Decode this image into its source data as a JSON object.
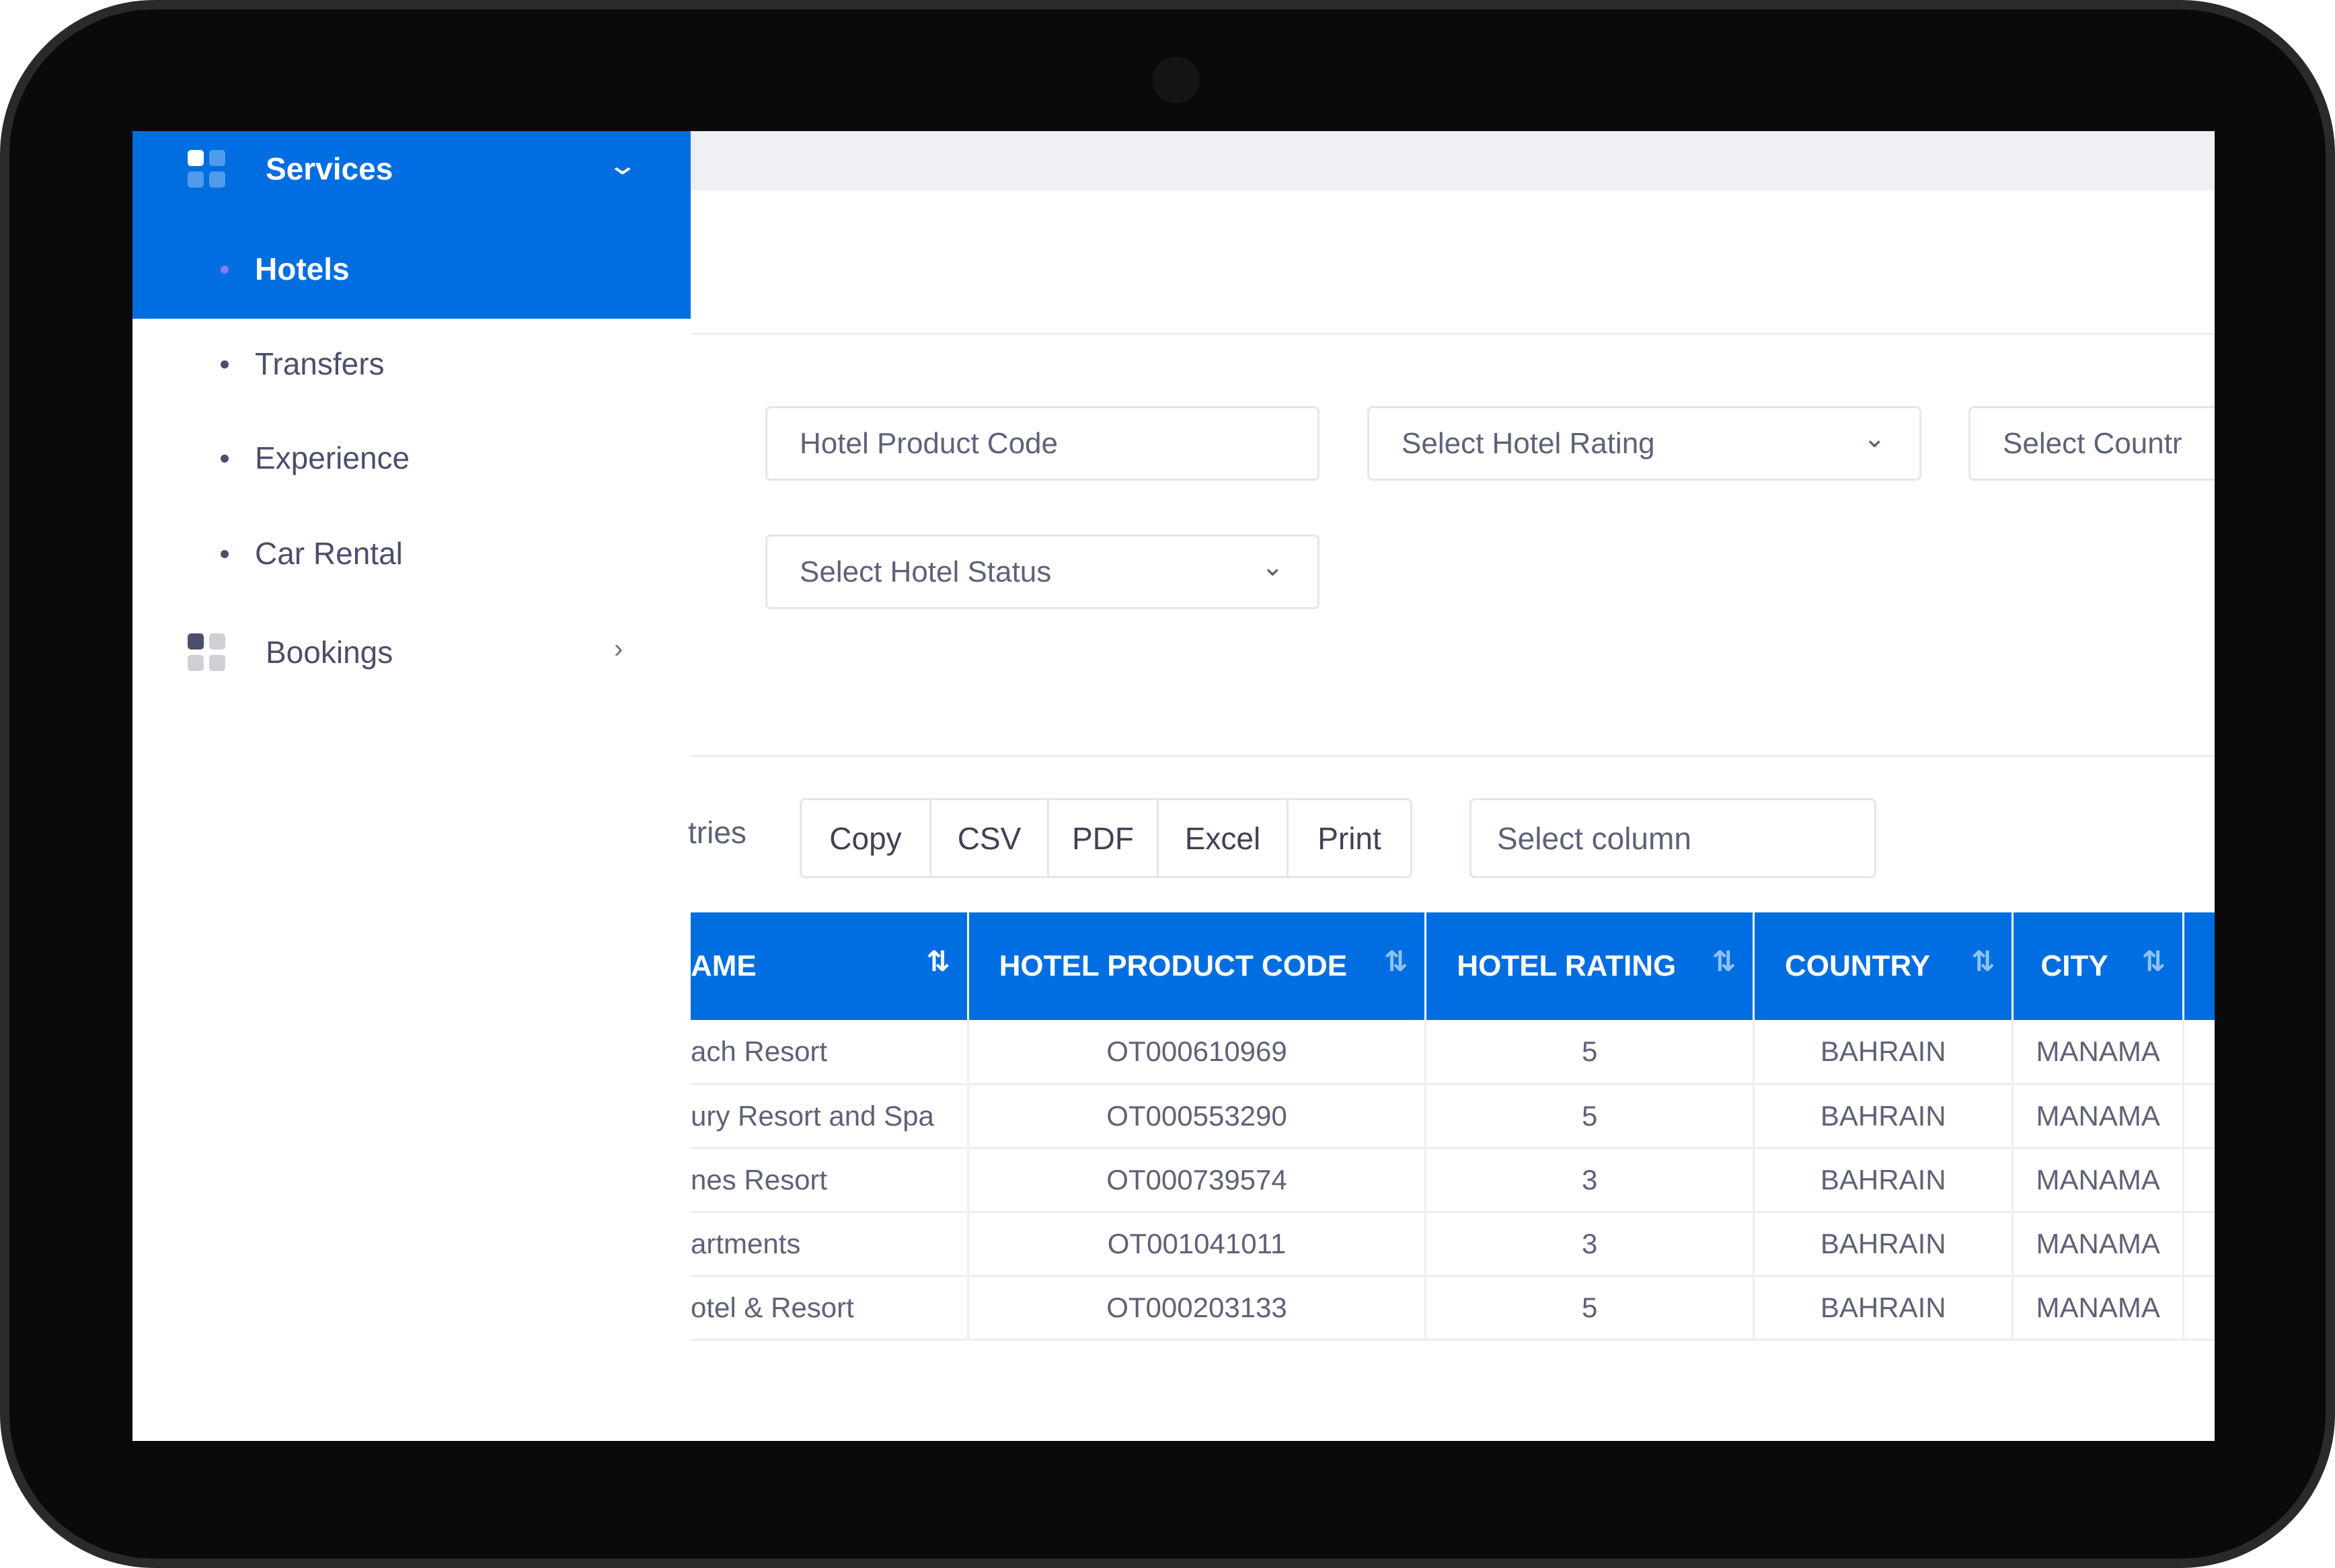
{
  "colors": {
    "accent": "#006ee0",
    "text": "#5e6278"
  },
  "sidebar": {
    "services": {
      "label": "Services",
      "icon": "grid-icon",
      "chevron": "chevron-down-icon"
    },
    "items": [
      {
        "label": "Hotels",
        "active": true
      },
      {
        "label": "Transfers"
      },
      {
        "label": "Experience"
      },
      {
        "label": "Car Rental"
      }
    ],
    "bookings": {
      "label": "Bookings",
      "icon": "grid-icon",
      "chevron": "chevron-right-icon"
    }
  },
  "filters": {
    "product_code_placeholder": "Hotel Product Code",
    "rating_placeholder": "Select Hotel Rating",
    "country_placeholder": "Select Countr",
    "status_placeholder": "Select Hotel Status"
  },
  "toolbar": {
    "entries_fragment": "tries",
    "copy": "Copy",
    "csv": "CSV",
    "pdf": "PDF",
    "excel": "Excel",
    "print": "Print",
    "column_placeholder": "Select column"
  },
  "table": {
    "headers": [
      "AME",
      "HOTEL PRODUCT CODE",
      "HOTEL RATING",
      "COUNTRY",
      "CITY"
    ],
    "rows": [
      [
        "ach Resort",
        "OT000610969",
        "5",
        "BAHRAIN",
        "MANAMA"
      ],
      [
        "ury Resort and Spa",
        "OT000553290",
        "5",
        "BAHRAIN",
        "MANAMA"
      ],
      [
        "nes Resort",
        "OT000739574",
        "3",
        "BAHRAIN",
        "MANAMA"
      ],
      [
        "artments",
        "OT001041011",
        "3",
        "BAHRAIN",
        "MANAMA"
      ],
      [
        "otel & Resort",
        "OT000203133",
        "5",
        "BAHRAIN",
        "MANAMA"
      ]
    ]
  }
}
